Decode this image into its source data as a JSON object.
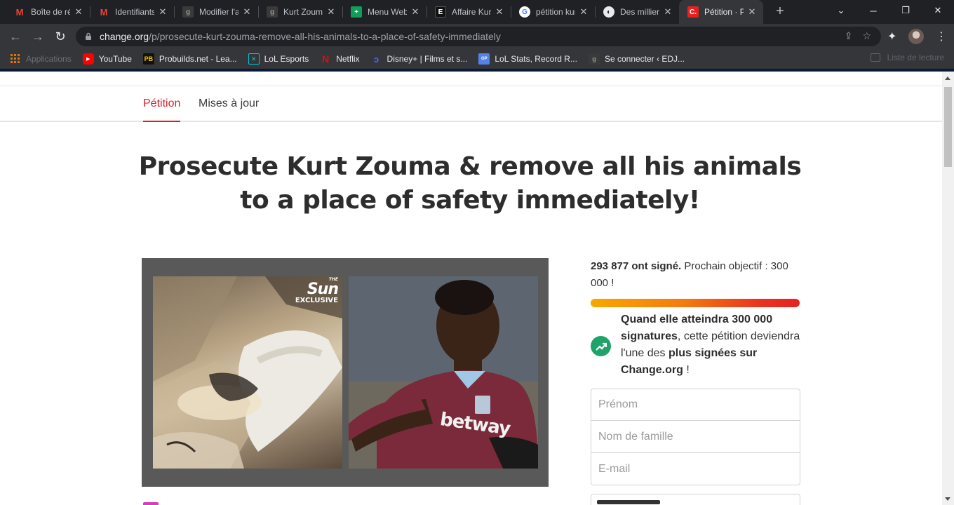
{
  "browser": {
    "tabs": [
      {
        "title": "Boîte de réception",
        "icon": "gmail-icon",
        "active": false
      },
      {
        "title": "Identifiants",
        "icon": "gmail-icon",
        "active": false
      },
      {
        "title": "Modifier l'article",
        "icon": "site-icon",
        "active": false
      },
      {
        "title": "Kurt Zouma",
        "icon": "site-icon",
        "active": false
      },
      {
        "title": "Menu Web",
        "icon": "sheets-icon",
        "active": false
      },
      {
        "title": "Affaire Kurt Zouma",
        "icon": "site-icon",
        "active": false
      },
      {
        "title": "pétition kurt zouma",
        "icon": "google-icon",
        "active": false
      },
      {
        "title": "Des milliers",
        "icon": "globe-icon",
        "active": false
      },
      {
        "title": "Pétition · Prosecute",
        "icon": "change-icon",
        "active": true
      }
    ],
    "url_host": "change.org",
    "url_path": "/p/prosecute-kurt-zouma-remove-all-his-animals-to-a-place-of-safety-immediately",
    "bookmarks": {
      "apps": "Applications",
      "items": [
        {
          "label": "YouTube",
          "icon": "youtube-icon",
          "color": "#ff0000"
        },
        {
          "label": "Probuilds.net - Lea...",
          "icon": "probuilds-icon",
          "color": "#f5c400"
        },
        {
          "label": "LoL Esports",
          "icon": "lol-esports-icon",
          "color": "#00c8d7"
        },
        {
          "label": "Netflix",
          "icon": "netflix-icon",
          "color": "#e50914"
        },
        {
          "label": "Disney+ | Films et s...",
          "icon": "disney-icon",
          "color": "#1f3c9c"
        },
        {
          "label": "LoL Stats, Record R...",
          "icon": "opgg-icon",
          "color": "#5383e8"
        },
        {
          "label": "Se connecter ‹ EDJ...",
          "icon": "site-icon",
          "color": "#444444"
        }
      ],
      "reading_list": "Liste de lecture"
    }
  },
  "page": {
    "tabs": {
      "petition": "Pétition",
      "updates": "Mises à jour"
    },
    "title": "Prosecute Kurt Zouma & remove all his animals to a place of safety immediately!",
    "media": {
      "badge_the": "THE",
      "badge_sun": "Sun",
      "badge_exclusive": "EXCLUSIVE",
      "shirt_sponsor": "betway"
    },
    "signatures": {
      "count": "293 877 ont signé.",
      "goal": " Prochain objectif : 300 000 !",
      "progress_fraction": 0.98
    },
    "milestone": {
      "part1": "Quand elle atteindra 300 000 signatures",
      "part2": ", cette pétition deviendra l'une des ",
      "part3": "plus signées sur Change.org",
      "part4": " !"
    },
    "form": {
      "first_name_placeholder": "Prénom",
      "last_name_placeholder": "Nom de famille",
      "email_placeholder": "E-mail"
    }
  },
  "colors": {
    "brand_red": "#d9202a",
    "green": "#1fa36a"
  }
}
